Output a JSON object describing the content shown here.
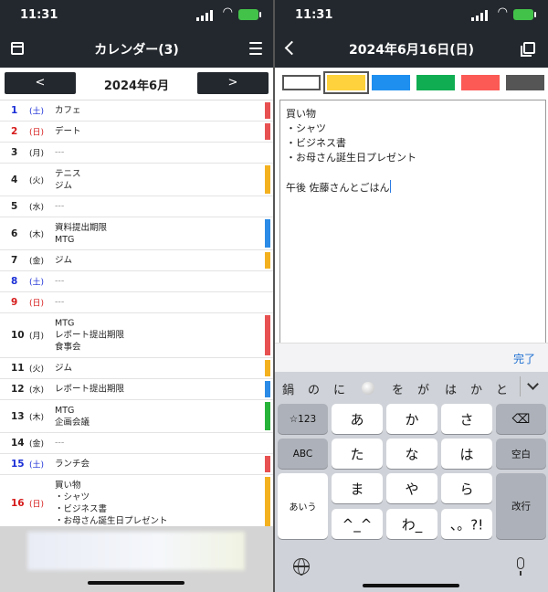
{
  "status": {
    "time": "11:31"
  },
  "left": {
    "title": "カレンダー(3)",
    "month_label": "2024年6月",
    "prev_label": "<",
    "next_label": ">",
    "rows": [
      {
        "day": "1",
        "dow": "(土)",
        "events": "カフェ",
        "color": "#e85151",
        "kind": "sat"
      },
      {
        "day": "2",
        "dow": "(日)",
        "events": "デート",
        "color": "#e85151",
        "kind": "sun"
      },
      {
        "day": "3",
        "dow": "(月)",
        "events": "---",
        "color": "",
        "kind": ""
      },
      {
        "day": "4",
        "dow": "(火)",
        "events": "テニス\nジム",
        "color": "#f4b11f",
        "kind": ""
      },
      {
        "day": "5",
        "dow": "(水)",
        "events": "---",
        "color": "",
        "kind": ""
      },
      {
        "day": "6",
        "dow": "(木)",
        "events": "資料提出期限\nMTG",
        "color": "#2b8be6",
        "kind": ""
      },
      {
        "day": "7",
        "dow": "(金)",
        "events": "ジム",
        "color": "#f4b11f",
        "kind": ""
      },
      {
        "day": "8",
        "dow": "(土)",
        "events": "---",
        "color": "",
        "kind": "sat"
      },
      {
        "day": "9",
        "dow": "(日)",
        "events": "---",
        "color": "",
        "kind": "sun"
      },
      {
        "day": "10",
        "dow": "(月)",
        "events": "MTG\nレポート提出期限\n食事会",
        "color": "#e85151",
        "kind": ""
      },
      {
        "day": "11",
        "dow": "(火)",
        "events": "ジム",
        "color": "#f4b11f",
        "kind": ""
      },
      {
        "day": "12",
        "dow": "(水)",
        "events": "レポート提出期限",
        "color": "#2b8be6",
        "kind": ""
      },
      {
        "day": "13",
        "dow": "(木)",
        "events": "MTG\n企画会議",
        "color": "#27b339",
        "kind": ""
      },
      {
        "day": "14",
        "dow": "(金)",
        "events": "---",
        "color": "",
        "kind": ""
      },
      {
        "day": "15",
        "dow": "(土)",
        "events": "ランチ会",
        "color": "#e85151",
        "kind": "sat"
      },
      {
        "day": "16",
        "dow": "(日)",
        "events": "買い物\n・シャツ\n・ビジネス書\n・お母さん誕生日プレゼント",
        "color": "#f4b11f",
        "kind": "sun"
      }
    ]
  },
  "right": {
    "title": "2024年6月16日(日)",
    "palette": [
      "#ffffff",
      "#fdd23c",
      "#1e8fef",
      "#10ad52",
      "#fb5a55",
      "#555555"
    ],
    "selected_color_index": 1,
    "note_text": "買い物\n・シャツ\n・ビジネス書\n・お母さん誕生日プレゼント\n\n午後 佐藤さんとごはん",
    "done_label": "完了",
    "candidates": [
      "鍋",
      "の",
      "に",
      "を",
      "が",
      "は",
      "か",
      "と"
    ],
    "keys": {
      "sym": "☆123",
      "a": "あ",
      "ka": "か",
      "sa": "さ",
      "abc": "ABC",
      "ta": "た",
      "na": "な",
      "ha": "は",
      "space": "空白",
      "aiu": "あいう",
      "ma": "ま",
      "ya": "や",
      "ra": "ら",
      "ret": "改行",
      "face": "^_^",
      "wa": "わ_",
      "punct": "、。?!"
    }
  }
}
